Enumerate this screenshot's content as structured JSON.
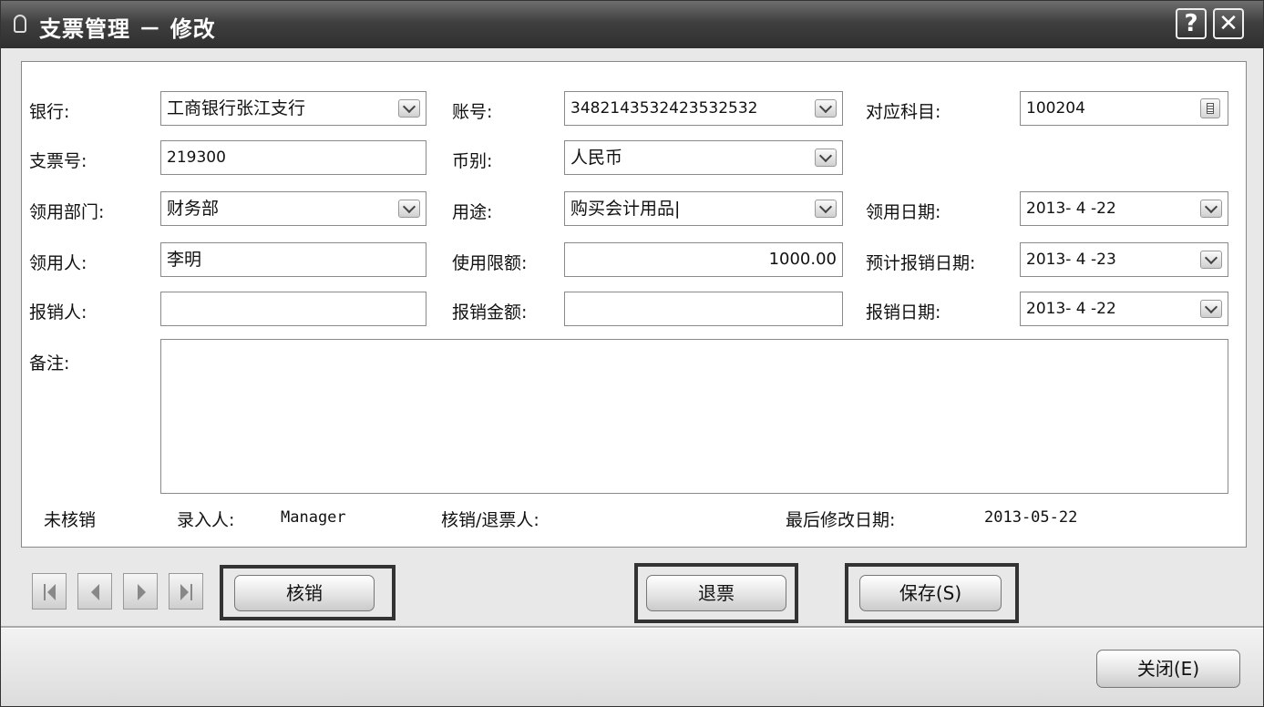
{
  "window": {
    "title": "支票管理 － 修改",
    "help_label": "?",
    "close_label": "✕"
  },
  "form": {
    "bank": {
      "label": "银行:",
      "value": "工商银行张江支行"
    },
    "account": {
      "label": "账号:",
      "value": "3482143532423532532"
    },
    "subject": {
      "label": "对应科目:",
      "value": "100204"
    },
    "cheque_no": {
      "label": "支票号:",
      "value": "219300"
    },
    "currency": {
      "label": "币别:",
      "value": "人民币"
    },
    "department": {
      "label": "领用部门:",
      "value": "财务部"
    },
    "purpose": {
      "label": "用途:",
      "value": "购买会计用品|"
    },
    "receive_date": {
      "label": "领用日期:",
      "value": "2013- 4 -22"
    },
    "receiver": {
      "label": "领用人:",
      "value": "李明"
    },
    "limit": {
      "label": "使用限额:",
      "value": "1000.00"
    },
    "expected_date": {
      "label": "预计报销日期:",
      "value": "2013- 4 -23"
    },
    "reimburser": {
      "label": "报销人:",
      "value": ""
    },
    "reimburse_amount": {
      "label": "报销金额:",
      "value": ""
    },
    "reimburse_date": {
      "label": "报销日期:",
      "value": "2013- 4 -22"
    },
    "memo": {
      "label": "备注:",
      "value": ""
    }
  },
  "status": {
    "state": "未核销",
    "entered_by_label": "录入人:",
    "entered_by": "Manager",
    "verifier_label": "核销/退票人:",
    "verifier": "",
    "last_modified_label": "最后修改日期:",
    "last_modified": "2013-05-22"
  },
  "actions": {
    "verify": "核销",
    "refund": "退票",
    "save": "保存(S)",
    "close": "关闭(E)"
  },
  "icons": {
    "nav": [
      "first-record-icon",
      "prev-record-icon",
      "next-record-icon",
      "last-record-icon"
    ]
  }
}
